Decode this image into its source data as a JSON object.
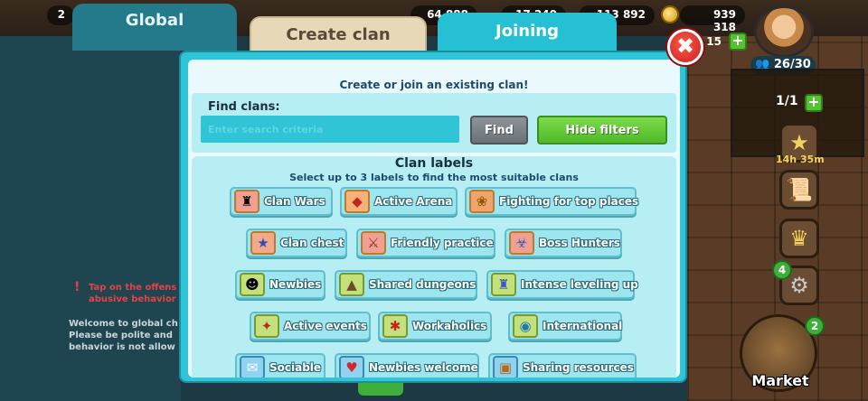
{
  "tabs": {
    "global": "Global",
    "create": "Create clan",
    "joining": "Joining"
  },
  "resources": {
    "left_count": "2",
    "r1": "64 888",
    "r2": "17 240",
    "r3": "113 892",
    "coins": "939 318",
    "gems": "15"
  },
  "player": {
    "population": "26/30",
    "slot": "1/1",
    "timer": "14h 35m",
    "settings_badge": "4",
    "market_badge": "2",
    "market_label": "Market"
  },
  "chat": {
    "warning": "Tap on the offens abusive behavior",
    "welcome": "Welcome to global ch Please be polite and behavior is not allow"
  },
  "dialog": {
    "subtitle": "Create or join an existing clan!",
    "find_label": "Find clans:",
    "search_placeholder": "Enter search criteria",
    "find_button": "Find",
    "filters_button": "Hide filters",
    "labels_title": "Clan labels",
    "labels_subtitle": "Select up to 3 labels to find the most suitable clans"
  },
  "clan_labels": [
    {
      "text": "Clan Wars",
      "icon": "tower-icon"
    },
    {
      "text": "Active Arena",
      "icon": "arena-gem-icon"
    },
    {
      "text": "Fighting for top places",
      "icon": "laurel-icon"
    },
    {
      "text": "Clan chest",
      "icon": "star-chest-icon"
    },
    {
      "text": "Friendly practice",
      "icon": "crossed-swords-icon"
    },
    {
      "text": "Boss Hunters",
      "icon": "boss-icon"
    },
    {
      "text": "Newbies",
      "icon": "newbie-hero-icon"
    },
    {
      "text": "Shared dungeons",
      "icon": "dungeon-icon"
    },
    {
      "text": "Intense leveling up",
      "icon": "castle-icon"
    },
    {
      "text": "Active events",
      "icon": "events-icon"
    },
    {
      "text": "Workaholics",
      "icon": "workaholics-icon"
    },
    {
      "text": "International",
      "icon": "globe-icon"
    },
    {
      "text": "Sociable",
      "icon": "chat-bubble-icon"
    },
    {
      "text": "Newbies welcome",
      "icon": "heart-icon"
    },
    {
      "text": "Sharing resources",
      "icon": "resource-box-icon"
    }
  ]
}
